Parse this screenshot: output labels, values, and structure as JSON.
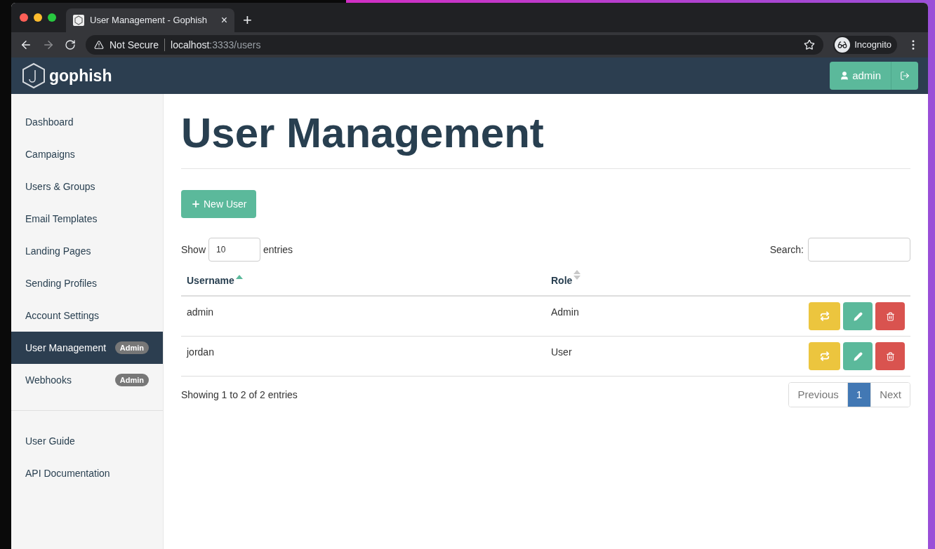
{
  "browser": {
    "tab_title": "User Management - Gophish",
    "tab_close": "×",
    "new_tab": "+",
    "security": "Not Secure",
    "url_host": "localhost",
    "url_path": ":3333/users",
    "profile": "Incognito"
  },
  "navbar": {
    "brand": "gophish",
    "user_button": "admin"
  },
  "sidebar": {
    "items": [
      {
        "label": "Dashboard",
        "selected": false
      },
      {
        "label": "Campaigns",
        "selected": false
      },
      {
        "label": "Users & Groups",
        "selected": false
      },
      {
        "label": "Email Templates",
        "selected": false
      },
      {
        "label": "Landing Pages",
        "selected": false
      },
      {
        "label": "Sending Profiles",
        "selected": false
      },
      {
        "label": "Account Settings",
        "selected": false
      },
      {
        "label": "User Management",
        "selected": true,
        "badge": "Admin"
      },
      {
        "label": "Webhooks",
        "selected": false,
        "badge": "Admin"
      }
    ],
    "links": [
      "User Guide",
      "API Documentation"
    ]
  },
  "page": {
    "title": "User Management",
    "new_button": "New User",
    "show_label": "Show",
    "entries_value": "10",
    "entries_label": "entries",
    "search_label": "Search:"
  },
  "table": {
    "columns": [
      {
        "label": "Username",
        "sorted": true
      },
      {
        "label": "Role",
        "sorted": false
      }
    ],
    "rows": [
      {
        "username": "admin",
        "role": "Admin"
      },
      {
        "username": "jordan",
        "role": "User"
      }
    ]
  },
  "footer": {
    "info": "Showing 1 to 2 of 2 entries",
    "pages": [
      {
        "label": "Previous",
        "selected": false
      },
      {
        "label": "1",
        "selected": true
      },
      {
        "label": "Next",
        "selected": false
      }
    ]
  }
}
